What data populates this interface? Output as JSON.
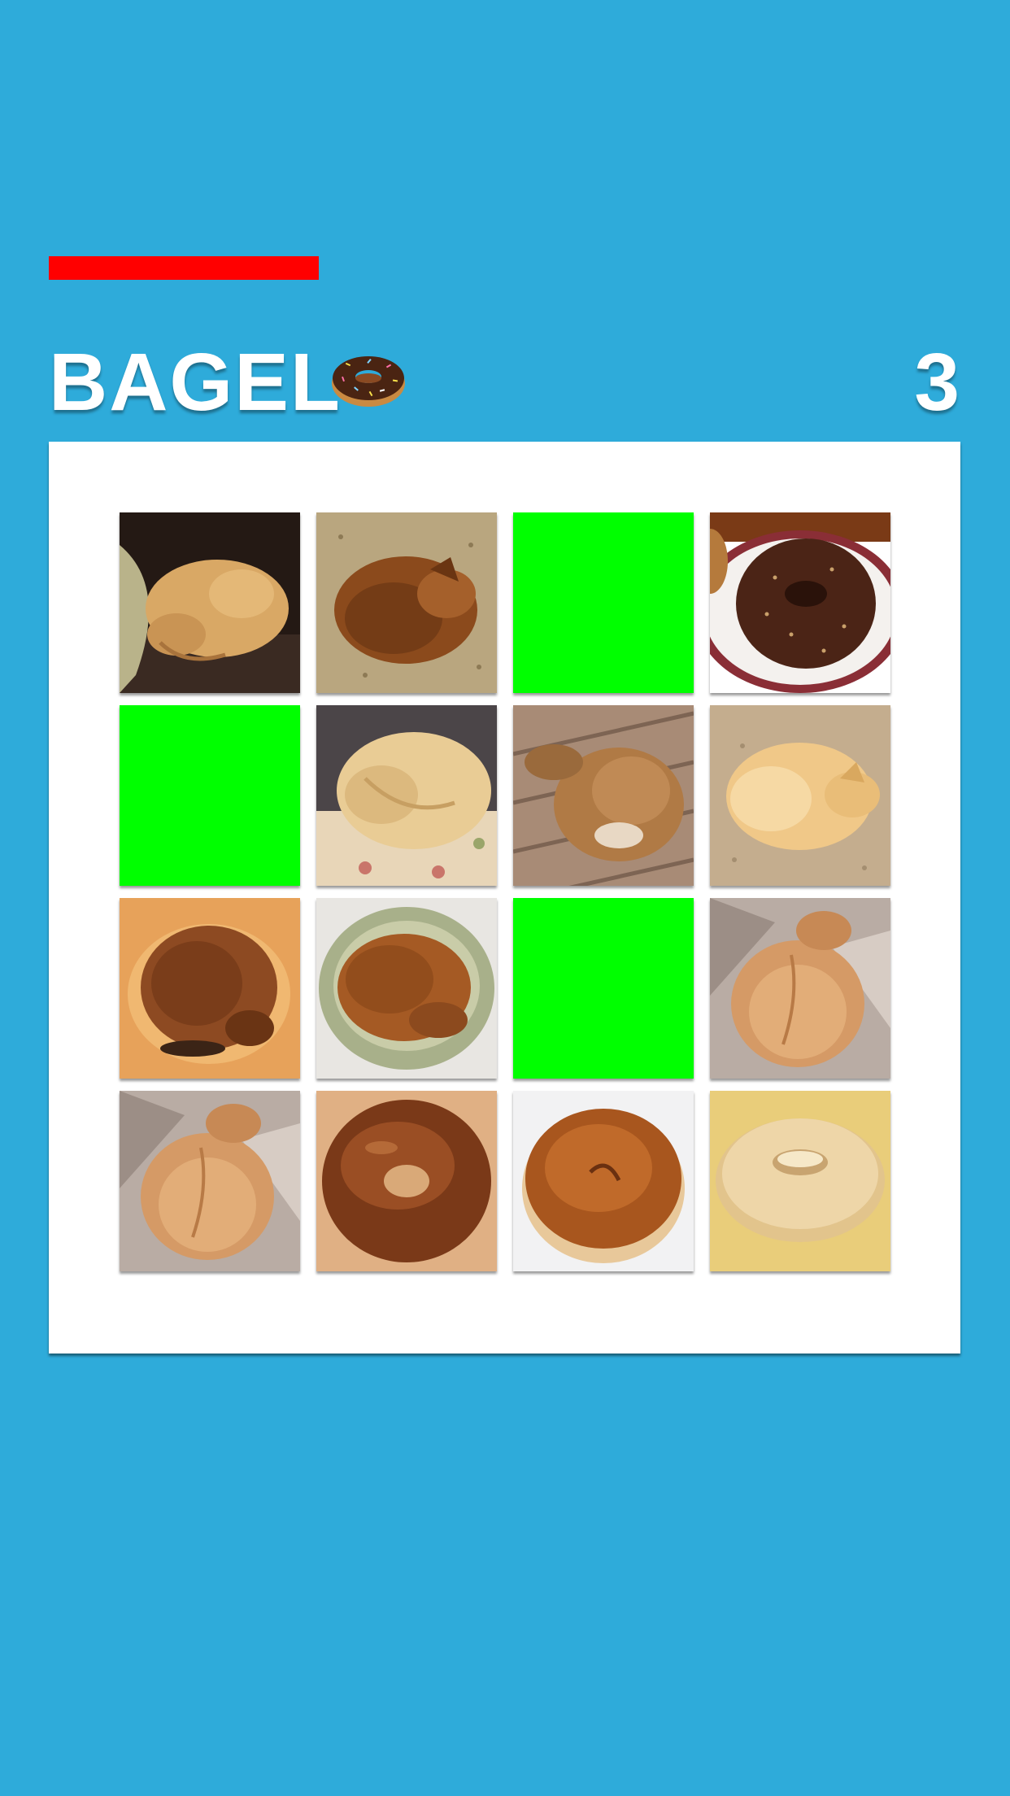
{
  "game": {
    "title": "BAGEL",
    "title_icon": "donut-icon",
    "score": "3",
    "timer_fraction": 0.21
  },
  "colors": {
    "background": "#2eabda",
    "timer": "#ff0000",
    "selected_tile": "#00ff00",
    "board": "#ffffff"
  },
  "tiles": [
    {
      "kind": "dog",
      "variant": "dog-on-black-couch",
      "selected": false
    },
    {
      "kind": "dog",
      "variant": "dog-on-dry-grass",
      "selected": false
    },
    {
      "kind": "selected",
      "variant": "green",
      "selected": true
    },
    {
      "kind": "bagel",
      "variant": "chocolate-bagel-on-plate",
      "selected": false
    },
    {
      "kind": "selected",
      "variant": "green",
      "selected": true
    },
    {
      "kind": "dog",
      "variant": "pale-dog-on-quilt",
      "selected": false
    },
    {
      "kind": "dog",
      "variant": "dog-on-wood-deck",
      "selected": false
    },
    {
      "kind": "dog",
      "variant": "pale-dog-on-sand",
      "selected": false
    },
    {
      "kind": "dog",
      "variant": "dog-on-orange-blanket",
      "selected": false
    },
    {
      "kind": "dog",
      "variant": "dog-in-green-bed",
      "selected": false
    },
    {
      "kind": "selected",
      "variant": "green",
      "selected": true
    },
    {
      "kind": "dog",
      "variant": "curled-dog-on-pillow",
      "selected": false
    },
    {
      "kind": "dog",
      "variant": "curled-dog-on-pillow",
      "selected": false
    },
    {
      "kind": "bagel",
      "variant": "dark-glazed-bagel",
      "selected": false
    },
    {
      "kind": "bagel",
      "variant": "golden-bagel-on-white",
      "selected": false
    },
    {
      "kind": "bagel",
      "variant": "plain-bagel-on-cornmeal",
      "selected": false
    }
  ]
}
